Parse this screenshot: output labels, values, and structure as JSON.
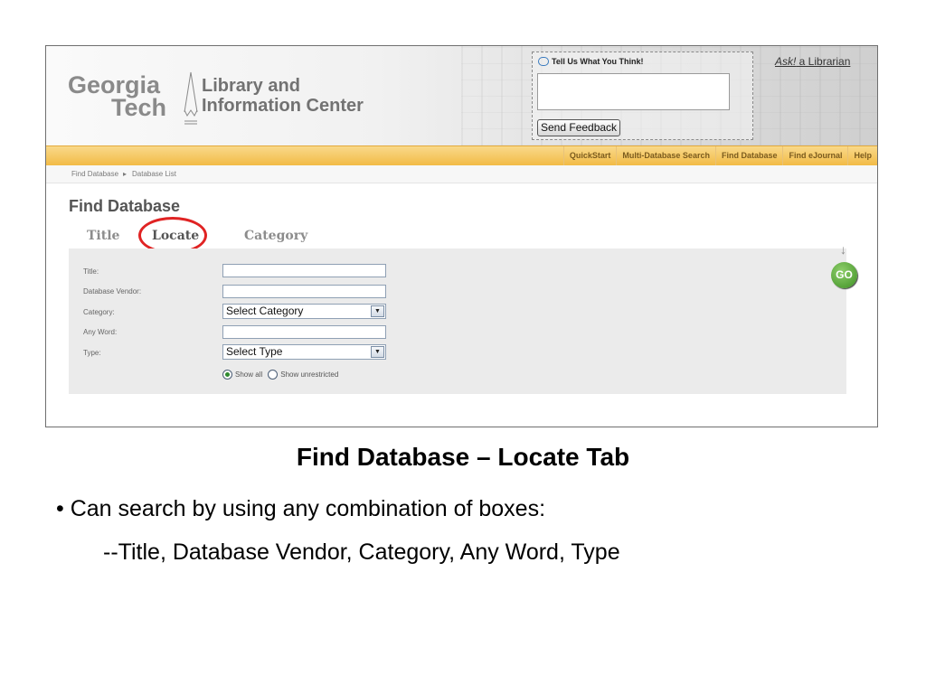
{
  "header": {
    "logo_georgia": "Georgia",
    "logo_tech": "Tech",
    "logo_library_line1": "Library and",
    "logo_library_line2": "Information Center"
  },
  "feedback": {
    "heading": "Tell Us What You Think!",
    "textarea_value": "",
    "send_label": "Send Feedback"
  },
  "ask": {
    "ask_word": "Ask!",
    "rest": " a Librarian"
  },
  "nav": {
    "items": [
      "QuickStart",
      "Multi-Database Search",
      "Find Database",
      "Find eJournal",
      "Help"
    ]
  },
  "breadcrumb": {
    "first": "Find Database",
    "separator": "▸",
    "second": "Database List"
  },
  "page": {
    "title": "Find Database"
  },
  "tabs": {
    "items": [
      "Title",
      "Locate",
      "Category"
    ],
    "active": "Locate"
  },
  "form": {
    "title_label": "Title:",
    "vendor_label": "Database Vendor:",
    "category_label": "Category:",
    "category_selected": "Select Category",
    "anyword_label": "Any Word:",
    "type_label": "Type:",
    "type_selected": "Select Type",
    "radio_show_all": "Show all",
    "radio_show_unrestricted": "Show unrestricted",
    "radio_selected": "Show all",
    "go_label": "GO"
  },
  "slide": {
    "heading": "Find Database – Locate Tab",
    "bullet_mark": "•",
    "bullet_text": "Can  search by using any combination of boxes:",
    "subline": "--Title, Database Vendor, Category, Any Word, Type"
  },
  "colors": {
    "accent_ring": "#e02323",
    "navbar": "#f2bb46",
    "go_button": "#3d8f22"
  }
}
